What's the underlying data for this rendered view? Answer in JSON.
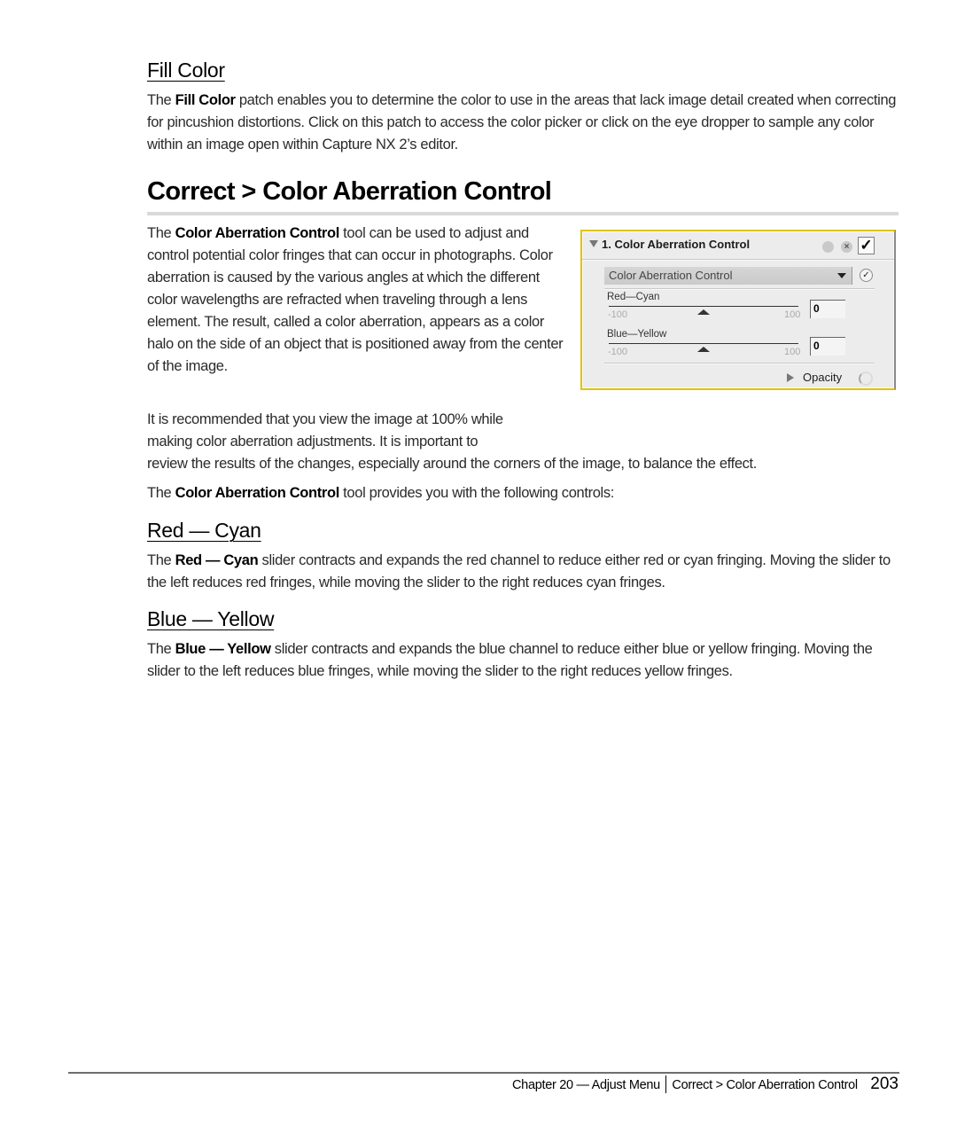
{
  "fill_color": {
    "heading": "Fill Color",
    "para": [
      {
        "text": "The ",
        "bold": false
      },
      {
        "text": "Fill Color",
        "bold": true
      },
      {
        "text": " patch enables you to determine the color to use in the areas that lack image detail created when correcting for pincushion distortions. Click on this patch to access the color picker or click on the eye dropper to sample any color within an image open within Capture NX 2’s editor.",
        "bold": false
      }
    ]
  },
  "section": {
    "title": "Correct > Color Aberration Control",
    "intro": [
      {
        "text": "The ",
        "bold": false
      },
      {
        "text": "Color Aberration Control",
        "bold": true
      },
      {
        "text": " tool can be used to adjust and control potential color fringes that can occur in photographs. Color aberration is caused by the various angles at which the different color wavelengths are refracted when traveling through a lens element. The result, called a color aberration, appears as a color halo on the side of an object that is positioned away from the center of the image.",
        "bold": false
      }
    ],
    "recommend_line1": "It is recommended that you view the image at 100% while",
    "recommend_line2": "making color aberration adjustments. It is important to",
    "recommend_line3": "review the results of the changes, especially around the corners of the image, to balance the effect.",
    "controls_intro": [
      {
        "text": "The ",
        "bold": false
      },
      {
        "text": "Color Aberration Control",
        "bold": true
      },
      {
        "text": " tool provides you with the following controls:",
        "bold": false
      }
    ]
  },
  "panel": {
    "title": "1. Color Aberration Control",
    "header_icons": [
      "reset-icon",
      "close-icon",
      "enable-checkbox"
    ],
    "checkbox_glyph": "✓",
    "dropdown_value": "Color Aberration Control",
    "sliders": [
      {
        "label": "Red—Cyan",
        "min": "-100",
        "max": "100",
        "value": "0",
        "position_fraction": 0.5
      },
      {
        "label": "Blue—Yellow",
        "min": "-100",
        "max": "100",
        "value": "0",
        "position_fraction": 0.5
      }
    ],
    "opacity_label": "Opacity",
    "accent_color": "#e0c400"
  },
  "red_cyan": {
    "heading": "Red — Cyan",
    "para": [
      {
        "text": "The ",
        "bold": false
      },
      {
        "text": "Red — Cyan",
        "bold": true
      },
      {
        "text": " slider contracts and expands the red channel to reduce either red or cyan fringing. Moving the slider to the left reduces red fringes, while moving the slider to the right reduces cyan fringes.",
        "bold": false
      }
    ]
  },
  "blue_yellow": {
    "heading": "Blue — Yellow",
    "para": [
      {
        "text": "The ",
        "bold": false
      },
      {
        "text": "Blue — Yellow",
        "bold": true
      },
      {
        "text": " slider contracts and expands the blue channel to reduce either blue or yellow fringing. Moving the slider to the left reduces blue fringes, while moving the slider to the right reduces yellow fringes.",
        "bold": false
      }
    ]
  },
  "footer": {
    "chapter": "Chapter 20 — Adjust Menu",
    "section": "Correct > Color Aberration Control",
    "page_number": "203"
  }
}
